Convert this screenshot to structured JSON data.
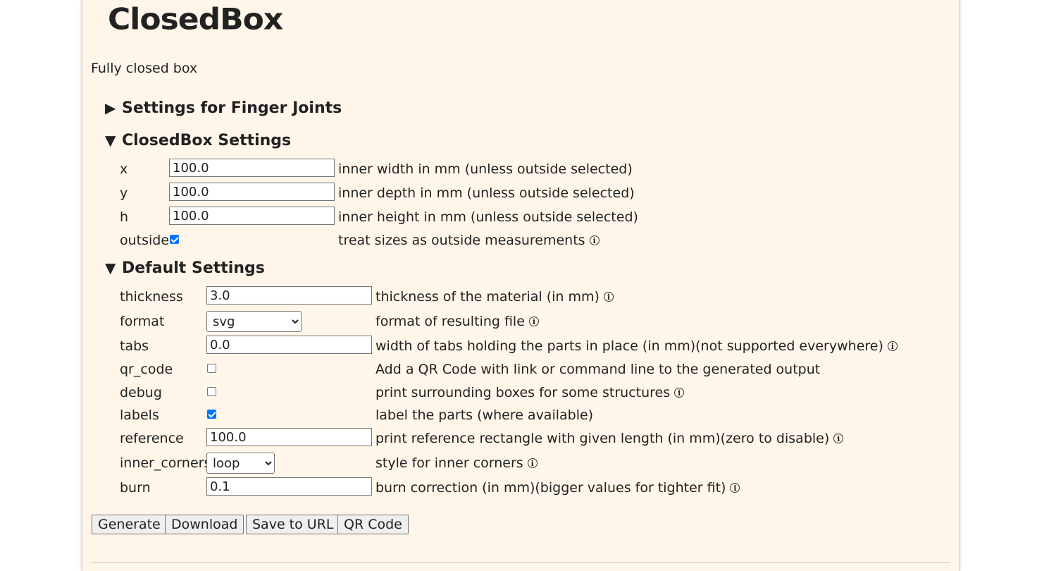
{
  "logo": {
    "text": "ClosedBox"
  },
  "description": "Fully closed box",
  "sections": {
    "finger": {
      "arrow": "▶",
      "title": "Settings for Finger Joints"
    },
    "closedbox": {
      "arrow": "▼",
      "title": "ClosedBox Settings"
    },
    "defaults": {
      "arrow": "▼",
      "title": "Default Settings"
    }
  },
  "closedbox": {
    "x": {
      "label": "x",
      "value": "100.0",
      "desc": "inner width in mm (unless outside selected)"
    },
    "y": {
      "label": "y",
      "value": "100.0",
      "desc": "inner depth in mm (unless outside selected)"
    },
    "h": {
      "label": "h",
      "value": "100.0",
      "desc": "inner height in mm (unless outside selected)"
    },
    "outside": {
      "label": "outside",
      "checked": true,
      "desc": "treat sizes as outside measurements"
    }
  },
  "defaults": {
    "thickness": {
      "label": "thickness",
      "value": "3.0",
      "desc": "thickness of the material (in mm)"
    },
    "format": {
      "label": "format",
      "value": "svg",
      "desc": "format of resulting file"
    },
    "tabs": {
      "label": "tabs",
      "value": "0.0",
      "desc": "width of tabs holding the parts in place (in mm)(not supported everywhere)"
    },
    "qr_code": {
      "label": "qr_code",
      "checked": false,
      "desc": "Add a QR Code with link or command line to the generated output"
    },
    "debug": {
      "label": "debug",
      "checked": false,
      "desc": "print surrounding boxes for some structures"
    },
    "labels": {
      "label": "labels",
      "checked": true,
      "desc": "label the parts (where available)"
    },
    "reference": {
      "label": "reference",
      "value": "100.0",
      "desc": "print reference rectangle with given length (in mm)(zero to disable)"
    },
    "inner_corners": {
      "label": "inner_corners",
      "value": "loop",
      "desc": "style for inner corners"
    },
    "burn": {
      "label": "burn",
      "value": "0.1",
      "desc": "burn correction (in mm)(bigger values for tighter fit)"
    }
  },
  "info_glyph": "i",
  "buttons": {
    "generate": "Generate",
    "download": "Download",
    "save_url": "Save to URL",
    "qr_code": "QR Code"
  },
  "colors": {
    "page_background": "#fff6e9",
    "checkbox_accent": "#0075ff"
  }
}
